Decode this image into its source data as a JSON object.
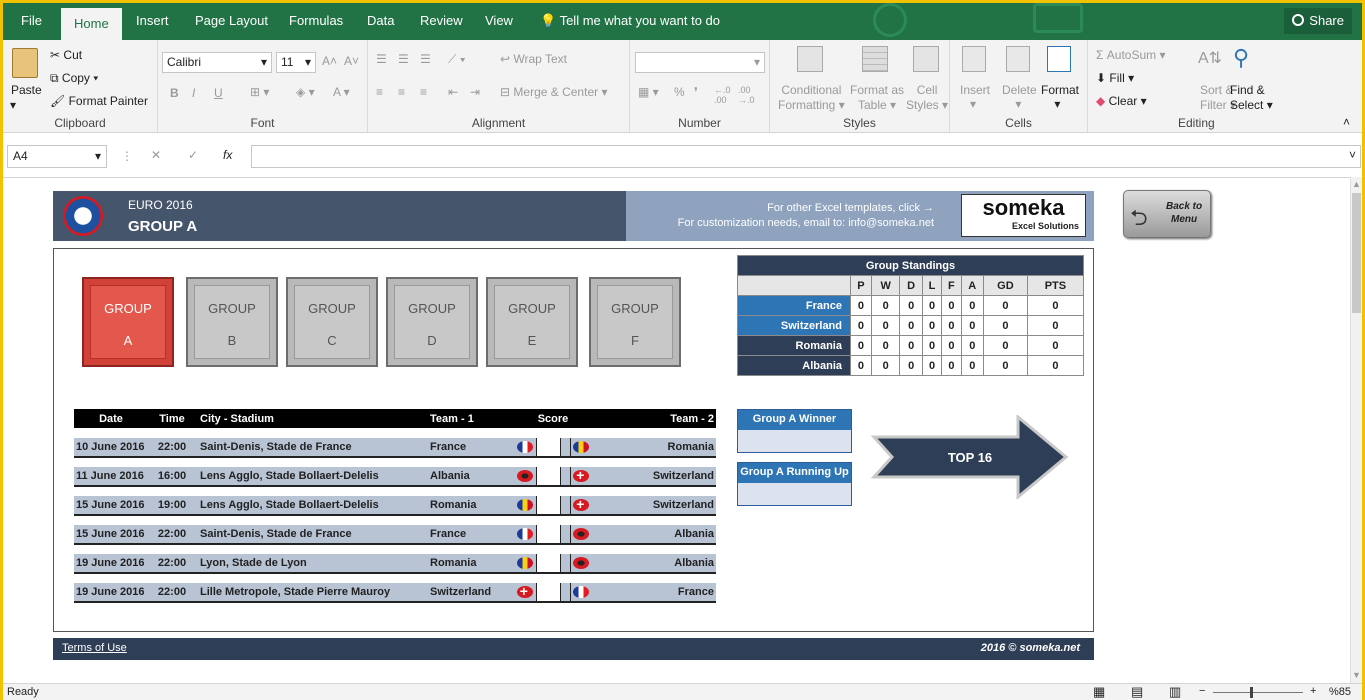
{
  "tabs": [
    "File",
    "Home",
    "Insert",
    "Page Layout",
    "Formulas",
    "Data",
    "Review",
    "View"
  ],
  "tell_me": "Tell me what you want to do",
  "share": "Share",
  "ribbon": {
    "clipboard": {
      "paste": "Paste",
      "cut": "Cut",
      "copy": "Copy",
      "format_painter": "Format Painter",
      "label": "Clipboard"
    },
    "font": {
      "name": "Calibri",
      "size": "11",
      "bold": "B",
      "italic": "I",
      "underline": "U",
      "label": "Font"
    },
    "alignment": {
      "wrap": "Wrap Text",
      "merge": "Merge & Center",
      "label": "Alignment"
    },
    "number": {
      "percent": "%",
      "label": "Number"
    },
    "styles": {
      "cond1": "Conditional",
      "cond2": "Formatting",
      "fmt1": "Format as",
      "fmt2": "Table",
      "cell1": "Cell",
      "cell2": "Styles",
      "label": "Styles"
    },
    "cells": {
      "insert": "Insert",
      "delete": "Delete",
      "format": "Format",
      "label": "Cells"
    },
    "editing": {
      "autosum": "AutoSum",
      "fill": "Fill",
      "clear": "Clear",
      "sort1": "Sort &",
      "sort2": "Filter",
      "find1": "Find &",
      "find2": "Select",
      "label": "Editing"
    }
  },
  "formula_bar": {
    "cell_ref": "A4",
    "value": ""
  },
  "header": {
    "line1": "EURO 2016",
    "line2": "GROUP A",
    "note1": "For other Excel templates, click →",
    "note2": "For customization needs, email to: info@someka.net",
    "logo": "someka",
    "logo_sub": "Excel Solutions",
    "back1": "Back to",
    "back2": "Menu"
  },
  "groups": [
    {
      "label": "GROUP",
      "letter": "A"
    },
    {
      "label": "GROUP",
      "letter": "B"
    },
    {
      "label": "GROUP",
      "letter": "C"
    },
    {
      "label": "GROUP",
      "letter": "D"
    },
    {
      "label": "GROUP",
      "letter": "E"
    },
    {
      "label": "GROUP",
      "letter": "F"
    }
  ],
  "standings": {
    "title": "Group Standings",
    "columns": [
      "P",
      "W",
      "D",
      "L",
      "F",
      "A",
      "GD",
      "PTS"
    ],
    "rows": [
      {
        "team": "France",
        "vals": [
          "0",
          "0",
          "0",
          "0",
          "0",
          "0",
          "0",
          "0"
        ]
      },
      {
        "team": "Switzerland",
        "vals": [
          "0",
          "0",
          "0",
          "0",
          "0",
          "0",
          "0",
          "0"
        ]
      },
      {
        "team": "Romania",
        "vals": [
          "0",
          "0",
          "0",
          "0",
          "0",
          "0",
          "0",
          "0"
        ]
      },
      {
        "team": "Albania",
        "vals": [
          "0",
          "0",
          "0",
          "0",
          "0",
          "0",
          "0",
          "0"
        ]
      }
    ]
  },
  "matches": {
    "headers": {
      "date": "Date",
      "time": "Time",
      "venue": "City - Stadium",
      "team1": "Team - 1",
      "score": "Score",
      "team2": "Team - 2"
    },
    "rows": [
      {
        "date": "10 June 2016",
        "time": "22:00",
        "venue": "Saint-Denis, Stade de France",
        "team1": "France",
        "team2": "Romania"
      },
      {
        "date": "11 June 2016",
        "time": "16:00",
        "venue": "Lens Agglo, Stade Bollaert-Delelis",
        "team1": "Albania",
        "team2": "Switzerland"
      },
      {
        "date": "15 June 2016",
        "time": "19:00",
        "venue": "Lens Agglo, Stade Bollaert-Delelis",
        "team1": "Romania",
        "team2": "Switzerland"
      },
      {
        "date": "15 June 2016",
        "time": "22:00",
        "venue": "Saint-Denis, Stade de France",
        "team1": "France",
        "team2": "Albania"
      },
      {
        "date": "19 June 2016",
        "time": "22:00",
        "venue": "Lyon, Stade de Lyon",
        "team1": "Romania",
        "team2": "Albania"
      },
      {
        "date": "19 June 2016",
        "time": "22:00",
        "venue": "Lille Metropole, Stade Pierre Mauroy",
        "team1": "Switzerland",
        "team2": "France"
      }
    ]
  },
  "winner": "Group A Winner",
  "runner": "Group A Running Up",
  "top16": "TOP 16",
  "footer": {
    "left": "Terms of Use",
    "right": "2016 © someka.net"
  },
  "status": {
    "ready": "Ready",
    "zoom": "%85"
  }
}
